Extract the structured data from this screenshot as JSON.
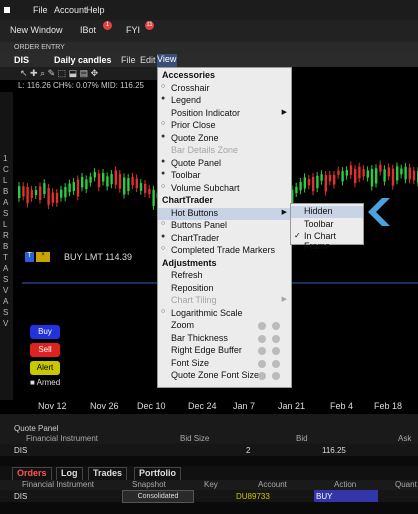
{
  "menubar": {
    "file": "File",
    "account": "Account",
    "help": "Help"
  },
  "toolbar": {
    "new_window": "New Window",
    "ibot": "IBot",
    "ibot_badge": "1",
    "fyi": "FYI",
    "fyi_badge": "11"
  },
  "order_entry": "ORDER ENTRY",
  "chart": {
    "symbol": "DIS",
    "style": "Daily candles",
    "menu_file": "File",
    "menu_edit": "Edit",
    "menu_view": "View",
    "info": "L: 116.26 CH%: 0.07%  MID: 116.25",
    "order_line": "BUY LMT 114.39",
    "left_letters": [
      "1",
      "C",
      "L",
      "B",
      "A",
      "S",
      "L",
      "R",
      "B",
      "T",
      "A",
      "S",
      "V",
      "A",
      "S",
      "V"
    ],
    "buy": "Buy",
    "sell": "Sell",
    "alert": "Alert",
    "armed": "Armed",
    "xaxis": [
      "Nov 12",
      "Nov 26",
      "Dec 10",
      "Dec 24",
      "Jan 7",
      "Jan 21",
      "Feb 4",
      "Feb 18"
    ]
  },
  "view_menu": {
    "accessories": "Accessories",
    "items1": [
      {
        "label": "Crosshair",
        "mark": "○"
      },
      {
        "label": "Legend",
        "mark": "●"
      },
      {
        "label": "Position Indicator",
        "mark": "",
        "arrow": "▶"
      },
      {
        "label": "Prior Close",
        "mark": "○"
      },
      {
        "label": "Quote Zone",
        "mark": "●"
      },
      {
        "label": "Bar Details Zone",
        "mark": "",
        "disabled": true
      },
      {
        "label": "Quote Panel",
        "mark": "●"
      },
      {
        "label": "Toolbar",
        "mark": "●"
      },
      {
        "label": "Volume Subchart",
        "mark": "○"
      }
    ],
    "chart_trader": "ChartTrader",
    "items2": [
      {
        "label": "Hot Buttons",
        "mark": "",
        "arrow": "▶",
        "highlight": true
      },
      {
        "label": "Buttons Panel",
        "mark": "○"
      },
      {
        "label": "ChartTrader",
        "mark": "●"
      },
      {
        "label": "Completed Trade Markers",
        "mark": "○"
      }
    ],
    "adjustments": "Adjustments",
    "items3": [
      {
        "label": "Refresh",
        "mark": ""
      },
      {
        "label": "Reposition",
        "mark": ""
      },
      {
        "label": "Chart Tiling",
        "mark": "",
        "disabled": true,
        "arrow": "▶"
      },
      {
        "label": "Logarithmic Scale",
        "mark": "○"
      },
      {
        "label": "Zoom",
        "mark": ""
      },
      {
        "label": "Bar Thickness",
        "mark": ""
      },
      {
        "label": "Right Edge Buffer",
        "mark": ""
      },
      {
        "label": "Font Size",
        "mark": ""
      },
      {
        "label": "Quote Zone Font Size",
        "mark": ""
      }
    ]
  },
  "submenu": [
    {
      "label": "Hidden",
      "mark": ""
    },
    {
      "label": "Toolbar",
      "mark": ""
    },
    {
      "label": "In Chart Frame",
      "mark": "✓"
    }
  ],
  "quote_panel": {
    "title": "Quote Panel",
    "headers": [
      "Financial Instrument",
      "Bid Size",
      "Bid",
      "Ask"
    ],
    "row": {
      "symbol": "DIS",
      "bid_size": "2",
      "bid": "116.25"
    }
  },
  "orders": {
    "tabs": [
      "Orders",
      "Log",
      "Trades",
      "Portfolio"
    ],
    "headers": [
      "Financial Instrument",
      "Snapshot",
      "Key",
      "Account",
      "Action",
      "Quant"
    ],
    "row": {
      "symbol": "DIS",
      "snapshot": "Consolidated",
      "account": "DU89733",
      "action": "BUY"
    }
  },
  "colors": {
    "accent": "#4aa3df",
    "buy": "#2233dd",
    "sell": "#dd2222",
    "alert": "#c8c800",
    "candle_up": "#2ecc40",
    "candle_down": "#e03030"
  }
}
